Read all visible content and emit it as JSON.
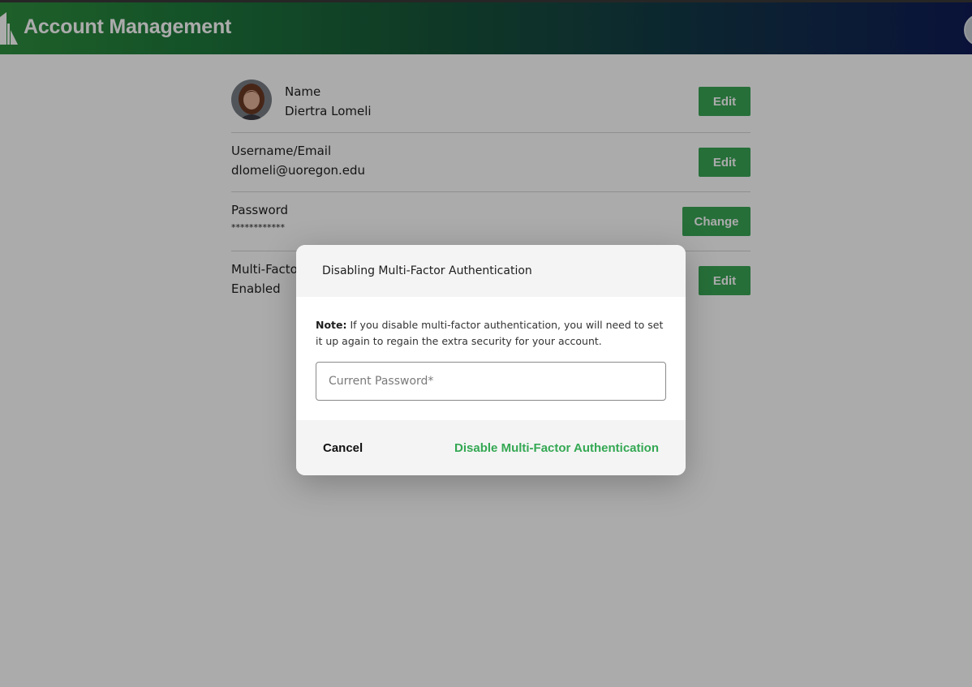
{
  "header": {
    "title": "Account Management",
    "logo_icon": "building-columns-icon",
    "avatar_icon": "user-avatar-icon",
    "colors": {
      "gradient_start": "#2f8f3f",
      "gradient_end": "#101c55"
    }
  },
  "account": {
    "name": {
      "label": "Name",
      "value": "Diertra Lomeli",
      "button": "Edit",
      "photo_icon": "profile-photo"
    },
    "username": {
      "label": "Username/Email",
      "value": "dlomeli@uoregon.edu",
      "button": "Edit"
    },
    "password": {
      "label": "Password",
      "value": "************",
      "button": "Change"
    },
    "mfa": {
      "label": "Multi-Factor",
      "value": "Enabled",
      "button": "Edit"
    }
  },
  "modal": {
    "title": "Disabling Multi-Factor Authentication",
    "note_prefix": "Note:",
    "note_text": " If you disable multi-factor authentication, you will need to set it up again to regain the extra security for your account.",
    "password_placeholder": "Current Password*",
    "password_value": "",
    "cancel_label": "Cancel",
    "confirm_label": "Disable Multi-Factor Authentication"
  },
  "colors": {
    "accent_green": "#3aa655",
    "link_green": "#34a853",
    "overlay": "rgba(0,0,0,0.33)"
  }
}
